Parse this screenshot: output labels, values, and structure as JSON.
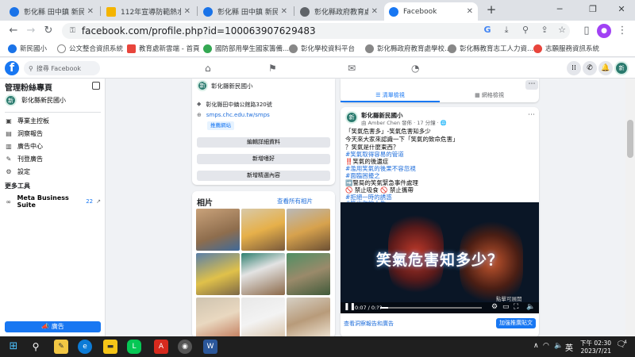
{
  "browser": {
    "tabs": [
      {
        "title": "彰化縣 田中鎮 新民國",
        "color": "#1a73e8"
      },
      {
        "title": "112年宣導防範熱水器",
        "color": "#f4b400"
      },
      {
        "title": "彰化縣 田中鎮 新民國",
        "color": "#1a73e8"
      },
      {
        "title": "彰化縣政府教育處學校",
        "color": "#5f6368"
      },
      {
        "title": "Facebook",
        "color": "#1877f2"
      }
    ],
    "url": "facebook.com/profile.php?id=100063907629483",
    "bookmarks": [
      "新民國小",
      "公文整合資訊系統",
      "教育處新雲端 - 首頁",
      "國防部用學生國家籌備...",
      "彰化學校資料平台",
      "彰化縣政府教育處學校...",
      "彰化縣教育志工人力資...",
      "志願服務資訊系統"
    ]
  },
  "fb": {
    "search_placeholder": "搜尋 Facebook",
    "profile_initial": "新",
    "left": {
      "title": "管理粉絲專頁",
      "page_name": "彰化縣新民國小",
      "items": [
        "專業主控板",
        "洞察報告",
        "廣告中心",
        "刊登廣告",
        "設定"
      ],
      "more_tools": "更多工具",
      "suite": "Meta Business Suite",
      "suite_badge": "22",
      "promote": "廣告"
    },
    "intro": {
      "address": "彰化縣田中鎮公館路320號",
      "website": "smps.chc.edu.tw/smps",
      "rating_btn": "推薦網站",
      "buttons": [
        "編輯詳細資料",
        "新增嗜好",
        "新增精選內容"
      ]
    },
    "photos": {
      "title": "相片",
      "see_all": "查看所有相片"
    },
    "feed": {
      "tabs": [
        "清單檢視",
        "網格檢視"
      ],
      "post_author": "彰化縣新民國小",
      "post_meta": "由 Amber Chen 發佈 · 17 分鐘 · 🌐",
      "lines": [
        "「笑氣危害多」-笑氣危害知多少",
        "今天來大家來認識一下「笑氣的致命危害」",
        "？笑氣是什麼東西？",
        "#笑氣取得容易的管道",
        "‼️笑氣的後遺症",
        "#濫用笑氣的後果不容忽視",
        "#面臨困擾之",
        "➡️警局的笑氣緊急事件處理",
        "🚫 禁止吸食 🚫 禁止攜帶",
        "#拒絕一時的誘惑",
        "#笑出你的人生"
      ],
      "video_title": "笑氣危害知多少？",
      "video_time": "0:07 / 0:??",
      "video_badge": "點擊可展開",
      "insights": "查看洞察報告和廣告",
      "boost": "加強推廣貼文"
    }
  },
  "taskbar": {
    "ime": "英",
    "time": "下午 02:30",
    "date": "2023/7/21",
    "notif": "4"
  }
}
